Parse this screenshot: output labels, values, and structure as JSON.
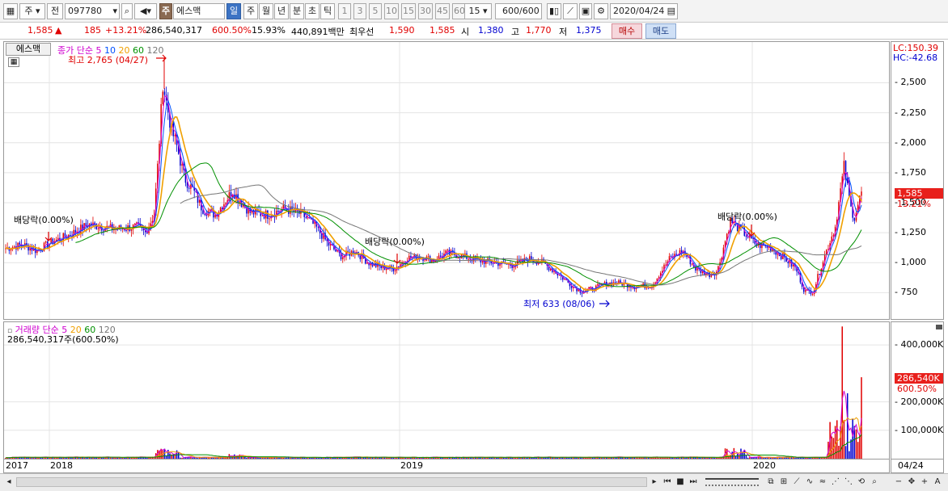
{
  "toolbar": {
    "market": "주",
    "period_prev": "전",
    "code": "097780",
    "stock_name_badge": "주",
    "stock_name": "에스맥",
    "tabs": [
      "일",
      "주",
      "월",
      "년",
      "분",
      "초",
      "틱"
    ],
    "intervals": [
      "1",
      "3",
      "5",
      "10",
      "15",
      "30",
      "45",
      "60"
    ],
    "interval_selected": "15",
    "count_value": "600",
    "count_total": "/600",
    "date": "2020/04/24"
  },
  "info": {
    "price": "1,585",
    "arrow": "▲",
    "change": "185",
    "change_pct": "+13.21%",
    "volume": "286,540,317",
    "volume_ratio": "600.50%",
    "turnover": "15.93%",
    "amount": "440,891백만",
    "priority_label": "최우선",
    "ask": "1,590",
    "bid": "1,585",
    "open_label": "시",
    "open": "1,380",
    "high_label": "고",
    "high": "1,770",
    "low_label": "저",
    "low": "1,375",
    "buy_label": "매수",
    "sell_label": "매도"
  },
  "price_panel": {
    "tab": "에스맥",
    "legend": {
      "close": "종가",
      "ma_type": "단순",
      "p5": "5",
      "p10": "10",
      "p20": "20",
      "p60": "60",
      "p120": "120"
    },
    "max_label": "최고 2,765 (04/27)",
    "min_label": "최저 633 (08/06)",
    "dividend_labels": [
      "배당락(0.00%)",
      "배당락(0.00%)",
      "배당락(0.00%)"
    ],
    "lc_label": "LC:150.39",
    "hc_label": "HC:-42.68",
    "y_ticks": [
      "2,500",
      "2,250",
      "2,000",
      "1,750",
      "1,500",
      "1,250",
      "1,000",
      "750"
    ],
    "y_tick_values": [
      2500,
      2250,
      2000,
      1750,
      1500,
      1250,
      1000,
      750
    ],
    "y_range": [
      530,
      2840
    ],
    "last_price_tag": "1,585",
    "last_change_tag": "13.21%"
  },
  "volume_panel": {
    "legend": {
      "name": "거래량",
      "ma_type": "단순",
      "p5": "5",
      "p20": "20",
      "p60": "60",
      "p120": "120"
    },
    "current": "286,540,317주(600.50%)",
    "y_ticks": [
      "400,000K",
      "200,000K",
      "100,000K"
    ],
    "y_tick_values": [
      400000,
      200000,
      100000
    ],
    "y_range": [
      0,
      480000
    ],
    "last_tag": "286,540K",
    "last_ratio_tag": "600.50%"
  },
  "x_axis": {
    "labels": [
      "2017",
      "2018",
      "2019",
      "2020"
    ],
    "end_label": "04/24"
  },
  "colors": {
    "up": "#e00000",
    "down": "#0000d0",
    "ma5": "#d000d0",
    "ma10": "#0050ff",
    "ma20": "#f0a000",
    "ma60": "#009000",
    "ma120": "#777777",
    "brand_blue": "#3c73c4"
  },
  "bottom": {
    "scroll_left": "◂",
    "scroll_right": "▸",
    "zoom_out": "−",
    "zoom_in": "+",
    "text_tool": "A"
  }
}
